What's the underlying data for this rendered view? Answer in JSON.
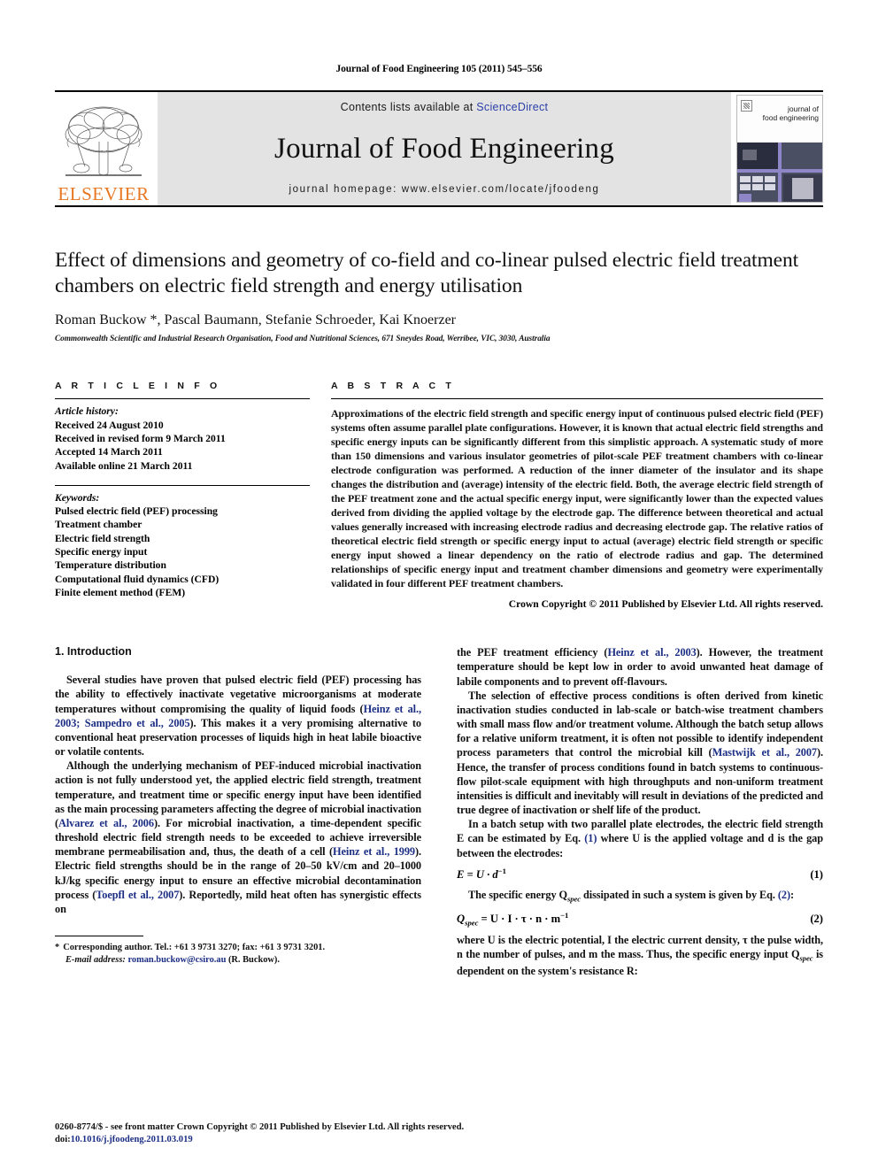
{
  "running_head": "Journal of Food Engineering 105 (2011) 545–556",
  "masthead": {
    "publisher_name": "ELSEVIER",
    "contents_prefix": "Contents lists available at ",
    "contents_link": "ScienceDirect",
    "journal_name": "Journal of Food Engineering",
    "homepage": "journal homepage: www.elsevier.com/locate/jfoodeng",
    "cover_title_line1": "journal of",
    "cover_title_line2": "food engineering"
  },
  "article": {
    "title": "Effect of dimensions and geometry of co-field and co-linear pulsed electric field treatment chambers on electric field strength and energy utilisation",
    "authors": "Roman Buckow *, Pascal Baumann, Stefanie Schroeder, Kai Knoerzer",
    "affiliation": "Commonwealth Scientific and Industrial Research Organisation, Food and Nutritional Sciences, 671 Sneydes Road, Werribee, VIC, 3030, Australia"
  },
  "article_info": {
    "heading": "A R T I C L E    I N F O",
    "history_label": "Article history:",
    "history": [
      "Received 24 August 2010",
      "Received in revised form 9 March 2011",
      "Accepted 14 March 2011",
      "Available online 21 March 2011"
    ],
    "keywords_label": "Keywords:",
    "keywords": [
      "Pulsed electric field (PEF) processing",
      "Treatment chamber",
      "Electric field strength",
      "Specific energy input",
      "Temperature distribution",
      "Computational fluid dynamics (CFD)",
      "Finite element method (FEM)"
    ]
  },
  "abstract": {
    "heading": "A B S T R A C T",
    "text": "Approximations of the electric field strength and specific energy input of continuous pulsed electric field (PEF) systems often assume parallel plate configurations. However, it is known that actual electric field strengths and specific energy inputs can be significantly different from this simplistic approach. A systematic study of more than 150 dimensions and various insulator geometries of pilot-scale PEF treatment chambers with co-linear electrode configuration was performed. A reduction of the inner diameter of the insulator and its shape changes the distribution and (average) intensity of the electric field. Both, the average electric field strength of the PEF treatment zone and the actual specific energy input, were significantly lower than the expected values derived from dividing the applied voltage by the electrode gap. The difference between theoretical and actual values generally increased with increasing electrode radius and decreasing electrode gap. The relative ratios of theoretical electric field strength or specific energy input to actual (average) electric field strength or specific energy input showed a linear dependency on the ratio of electrode radius and gap. The determined relationships of specific energy input and treatment chamber dimensions and geometry were experimentally validated in four different PEF treatment chambers.",
    "copyright": "Crown Copyright © 2011 Published by Elsevier Ltd. All rights reserved."
  },
  "body": {
    "section_heading": "1. Introduction",
    "left_paragraphs": [
      {
        "segments": [
          {
            "t": "Several studies have proven that pulsed electric field (PEF) processing has the ability to effectively inactivate vegetative microorganisms at moderate temperatures without compromising the quality of liquid foods (",
            "k": "text"
          },
          {
            "t": "Heinz et al., 2003; Sampedro et al., 2005",
            "k": "link"
          },
          {
            "t": "). This makes it a very promising alternative to conventional heat preservation processes of liquids high in heat labile bioactive or volatile contents.",
            "k": "text"
          }
        ]
      },
      {
        "segments": [
          {
            "t": "Although the underlying mechanism of PEF-induced microbial inactivation action is not fully understood yet, the applied electric field strength, treatment temperature, and treatment time or specific energy input have been identified as the main processing parameters affecting the degree of microbial inactivation (",
            "k": "text"
          },
          {
            "t": "Alvarez et al., 2006",
            "k": "link"
          },
          {
            "t": "). For microbial inactivation, a time-dependent specific threshold electric field strength needs to be exceeded to achieve irreversible membrane permeabilisation and, thus, the death of a cell (",
            "k": "text"
          },
          {
            "t": "Heinz et al., 1999",
            "k": "link"
          },
          {
            "t": "). Electric field strengths should be in the range of 20–50 kV/cm and 20–1000 kJ/kg specific energy input to ensure an effective microbial decontamination process (",
            "k": "text"
          },
          {
            "t": "Toepfl et al., 2007",
            "k": "link"
          },
          {
            "t": "). Reportedly, mild heat often has synergistic effects on",
            "k": "text"
          }
        ]
      }
    ],
    "right_paragraphs": [
      {
        "indent": false,
        "segments": [
          {
            "t": "the PEF treatment efficiency (",
            "k": "text"
          },
          {
            "t": "Heinz et al., 2003",
            "k": "link"
          },
          {
            "t": "). However, the treatment temperature should be kept low in order to avoid unwanted heat damage of labile components and to prevent off-flavours.",
            "k": "text"
          }
        ]
      },
      {
        "indent": true,
        "segments": [
          {
            "t": "The selection of effective process conditions is often derived from kinetic inactivation studies conducted in lab-scale or batch-wise treatment chambers with small mass flow and/or treatment volume. Although the batch setup allows for a relative uniform treatment, it is often not possible to identify independent process parameters that control the microbial kill (",
            "k": "text"
          },
          {
            "t": "Mastwijk et al., 2007",
            "k": "link"
          },
          {
            "t": "). Hence, the transfer of process conditions found in batch systems to continuous-flow pilot-scale equipment with high throughputs and non-uniform treatment intensities is difficult and inevitably will result in deviations of the predicted and true degree of inactivation or shelf life of the product.",
            "k": "text"
          }
        ]
      },
      {
        "indent": true,
        "segments": [
          {
            "t": "In a batch setup with two parallel plate electrodes, the electric field strength E can be estimated by Eq. ",
            "k": "text"
          },
          {
            "t": "(1)",
            "k": "link"
          },
          {
            "t": " where U is the applied voltage and d is the gap between the electrodes:",
            "k": "text"
          }
        ]
      }
    ],
    "equation1": {
      "body": "E = U · d",
      "exp": "−1",
      "number": "(1)"
    },
    "eq2_lead": [
      {
        "t": "The specific energy Q",
        "k": "text"
      },
      {
        "t": "spec",
        "k": "sub"
      },
      {
        "t": " dissipated in such a system is given by Eq. ",
        "k": "text"
      },
      {
        "t": "(2)",
        "k": "link"
      },
      {
        "t": ":",
        "k": "text"
      }
    ],
    "equation2": {
      "lhs": "Q",
      "lhs_sub": "spec",
      "body": " = U · I · τ · n · m",
      "exp": "−1",
      "number": "(2)"
    },
    "after_eq2": [
      {
        "t": "where U is the electric potential, I the electric current density, τ the pulse width, n the number of pulses, and m the mass. Thus, the specific energy input Q",
        "k": "text"
      },
      {
        "t": "spec",
        "k": "sub"
      },
      {
        "t": " is dependent on the system's resistance R:",
        "k": "text"
      }
    ]
  },
  "footnote": {
    "star": "*",
    "line1": "Corresponding author. Tel.: +61 3 9731 3270; fax: +61 3 9731 3201.",
    "email_label": "E-mail address:",
    "email": "roman.buckow@csiro.au",
    "email_suffix": "(R. Buckow)."
  },
  "page_footer": {
    "line1": "0260-8774/$ - see front matter Crown Copyright © 2011 Published by Elsevier Ltd. All rights reserved.",
    "doi_label": "doi:",
    "doi": "10.1016/j.jfoodeng.2011.03.019"
  },
  "colors": {
    "link": "#1c2f85",
    "elsevier_orange": "#E87722",
    "masthead_grey": "#e3e3e3"
  }
}
